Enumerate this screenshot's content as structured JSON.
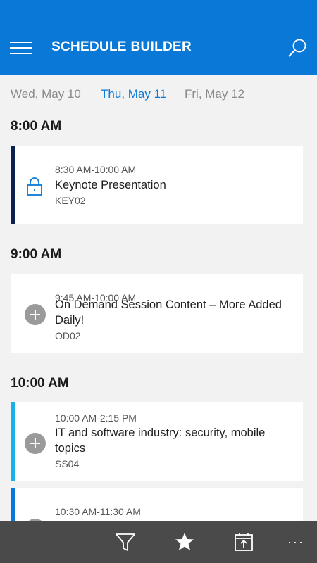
{
  "header": {
    "title": "SCHEDULE BUILDER",
    "menu_icon": "hamburger-icon",
    "search_icon": "search-icon",
    "background": "#0a78d7"
  },
  "days": [
    {
      "label": "Wed, May 10",
      "active": false
    },
    {
      "label": "Thu, May 11",
      "active": true
    },
    {
      "label": "Fri, May 12",
      "active": false
    }
  ],
  "timeline": {
    "groups": [
      {
        "time": "8:00 AM",
        "sessions": [
          {
            "slot": "8:30 AM-10:00 AM",
            "title": "Keynote Presentation",
            "code": "KEY02",
            "icon": "lock-icon",
            "accent": "#0b2250"
          }
        ]
      },
      {
        "time": "9:00 AM",
        "sessions": [
          {
            "slot": "9:45 AM-10:00 AM",
            "title": "On Demand Session Content – More Added Daily!",
            "code": "OD02",
            "icon": "add-icon",
            "accent": ""
          }
        ]
      },
      {
        "time": "10:00 AM",
        "sessions": [
          {
            "slot": "10:00 AM-2:15 PM",
            "title": "IT and software industry: security, mobile topics",
            "code": "SS04",
            "icon": "add-icon",
            "accent": "#1ab0e8"
          },
          {
            "slot": "10:30 AM-11:30 AM",
            "title": "",
            "code": "",
            "icon": "add-icon",
            "accent": "#0a78d7"
          }
        ]
      }
    ]
  },
  "appbar": {
    "filter_icon": "filter-icon",
    "favorites_icon": "star-icon",
    "calendar_icon": "calendar-export-icon",
    "more_label": "···"
  }
}
